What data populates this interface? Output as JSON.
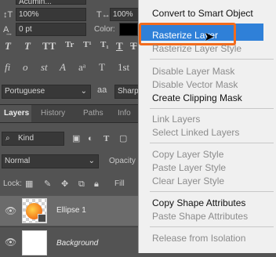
{
  "character_panel": {
    "font_name": "Acumin...",
    "scale_value": "100%",
    "baseline_value": "0 pt",
    "color_label": "Color:",
    "scale_right_value": "100%",
    "language": "Portuguese",
    "aa_value": "Sharp",
    "tt_buttons": [
      "T",
      "T",
      "TT",
      "Tr",
      "T¹",
      "T₁",
      "T",
      "T"
    ]
  },
  "layers_panel": {
    "tabs": [
      "Layers",
      "History",
      "Paths",
      "Info"
    ],
    "filter_kind": "Kind",
    "blend_mode": "Normal",
    "opacity_label": "Opacity",
    "lock_label": "Lock:",
    "fill_label": "Fill",
    "layers": [
      {
        "name": "Ellipse 1"
      },
      {
        "name": "Background"
      }
    ]
  },
  "context_menu": {
    "items": [
      {
        "label": "Convert to Smart Object",
        "enabled": true
      },
      {
        "label": "Rasterize Layer",
        "enabled": true,
        "highlighted": true
      },
      {
        "label": "Rasterize Layer Style",
        "enabled": false
      },
      {
        "label": "Disable Layer Mask",
        "enabled": false
      },
      {
        "label": "Disable Vector Mask",
        "enabled": false
      },
      {
        "label": "Create Clipping Mask",
        "enabled": true
      },
      {
        "label": "Link Layers",
        "enabled": false
      },
      {
        "label": "Select Linked Layers",
        "enabled": false
      },
      {
        "label": "Copy Layer Style",
        "enabled": false
      },
      {
        "label": "Paste Layer Style",
        "enabled": false
      },
      {
        "label": "Clear Layer Style",
        "enabled": false
      },
      {
        "label": "Copy Shape Attributes",
        "enabled": true
      },
      {
        "label": "Paste Shape Attributes",
        "enabled": false
      },
      {
        "label": "Release from Isolation",
        "enabled": false
      }
    ]
  },
  "colors": {
    "panel_bg": "#535353",
    "menu_bg": "#f0f0f0",
    "highlight": "#2f80d8",
    "annotation_outline": "#f26b1d"
  }
}
